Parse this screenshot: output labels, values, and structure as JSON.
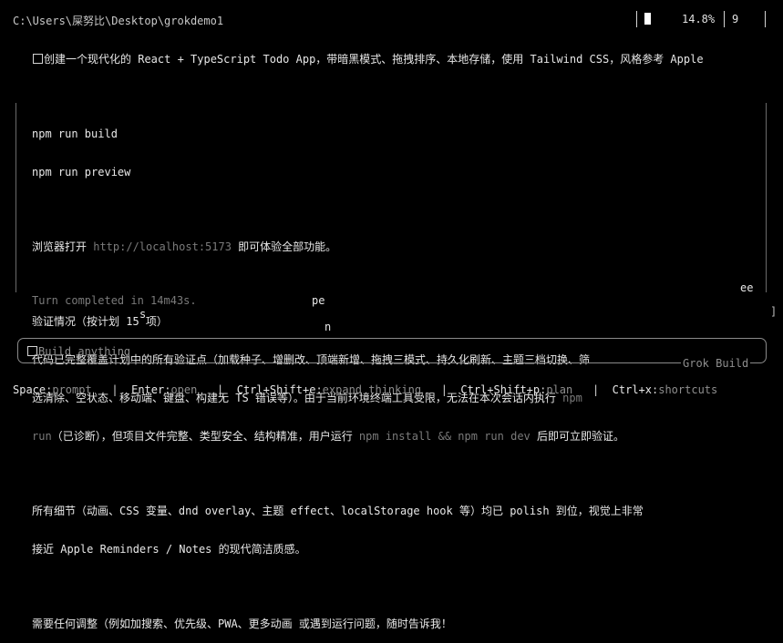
{
  "window": {
    "path": "C:\\Users\\屎努比\\Desktop\\grokdemo1",
    "status_percent": "14.8%",
    "status_count": "9"
  },
  "prompt": {
    "text": "创建一个现代化的 React + TypeScript Todo App，带暗黑模式、拖拽排序、本地存储，使用 Tailwind CSS，风格参考 Apple"
  },
  "content": {
    "cmd_build": "npm run build",
    "cmd_preview": "npm run preview",
    "browser_pre": "浏览器打开 ",
    "browser_url": "http://localhost:5173",
    "browser_post": " 即可体验全部功能。",
    "verify_title": "验证情况（按计划 15 项）",
    "verify_l1": "代码已完整覆盖计划中的所有验证点（加载种子、增删改、顶端新增、拖拽三模式、持久化刷新、主题三档切换、筛",
    "verify_l2_pre": "选清除、空状态、移动端、键盘、构建无 TS 错误等）。由于当前环境终端工具受限，无法在本次会话内执行 ",
    "verify_l2_dim": "npm",
    "verify_l3_dim1": "run",
    "verify_l3_mid": "（已诊断），但项目文件完整、类型安全、结构精准，用户运行 ",
    "verify_l3_dim2": "npm install && npm run dev",
    "verify_l3_post": " 后即可立即验证。",
    "detail_l1": "所有细节（动画、CSS 变量、dnd overlay、主题 effect、localStorage hook 等）均已 polish 到位，视觉上非常",
    "detail_l2": "接近 Apple Reminders / Notes 的现代简洁质感。",
    "closing": "需要任何调整（例如加搜索、优先级、PWA、更多动画 或遇到运行问题，随时告诉我！",
    "turn_completed": "Turn completed in 14m43s.",
    "frag_pe": "pe",
    "frag_ee": "ee",
    "frag_s": "s",
    "frag_n": "n",
    "frag_bracket": "]"
  },
  "input": {
    "placeholder": "Build anything",
    "mode_label": "Grok Build"
  },
  "shortcuts": [
    {
      "key": "Space",
      "desc": "prompt"
    },
    {
      "key": "Enter",
      "desc": "open"
    },
    {
      "key": "Ctrl+Shift+e",
      "desc": "expand thinking"
    },
    {
      "key": "Ctrl+Shift+p",
      "desc": "plan"
    },
    {
      "key": "Ctrl+x",
      "desc": "shortcuts"
    }
  ],
  "colors": {
    "background": "#000000",
    "text": "#e8e8e8",
    "dim": "#7a7a7a"
  }
}
